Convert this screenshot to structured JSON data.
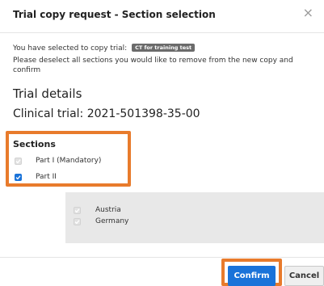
{
  "dialog": {
    "title": "Trial copy request - Section selection",
    "close_symbol": "×"
  },
  "intro": {
    "selected_text": "You have selected to copy trial:",
    "trial_badge": "CT for training test",
    "instruction": "Please deselect all sections you would like to remove from the new copy and confirm"
  },
  "details": {
    "heading": "Trial details",
    "clinical_trial": "Clinical trial: 2021-501398-35-00"
  },
  "sections": {
    "title": "Sections",
    "items": [
      {
        "label": "Part I (Mandatory)",
        "checked": true,
        "disabled": true
      },
      {
        "label": "Part II",
        "checked": true,
        "disabled": false
      }
    ]
  },
  "countries": [
    {
      "label": "Austria",
      "checked": true,
      "disabled": true
    },
    {
      "label": "Germany",
      "checked": true,
      "disabled": true
    }
  ],
  "buttons": {
    "confirm": "Confirm",
    "cancel": "Cancel"
  },
  "colors": {
    "accent": "#1a73d9",
    "highlight": "#e87b2c",
    "panel": "#e8e8e8"
  },
  "icons": {
    "close": "close-icon",
    "checkbox": "checkmark-icon"
  }
}
